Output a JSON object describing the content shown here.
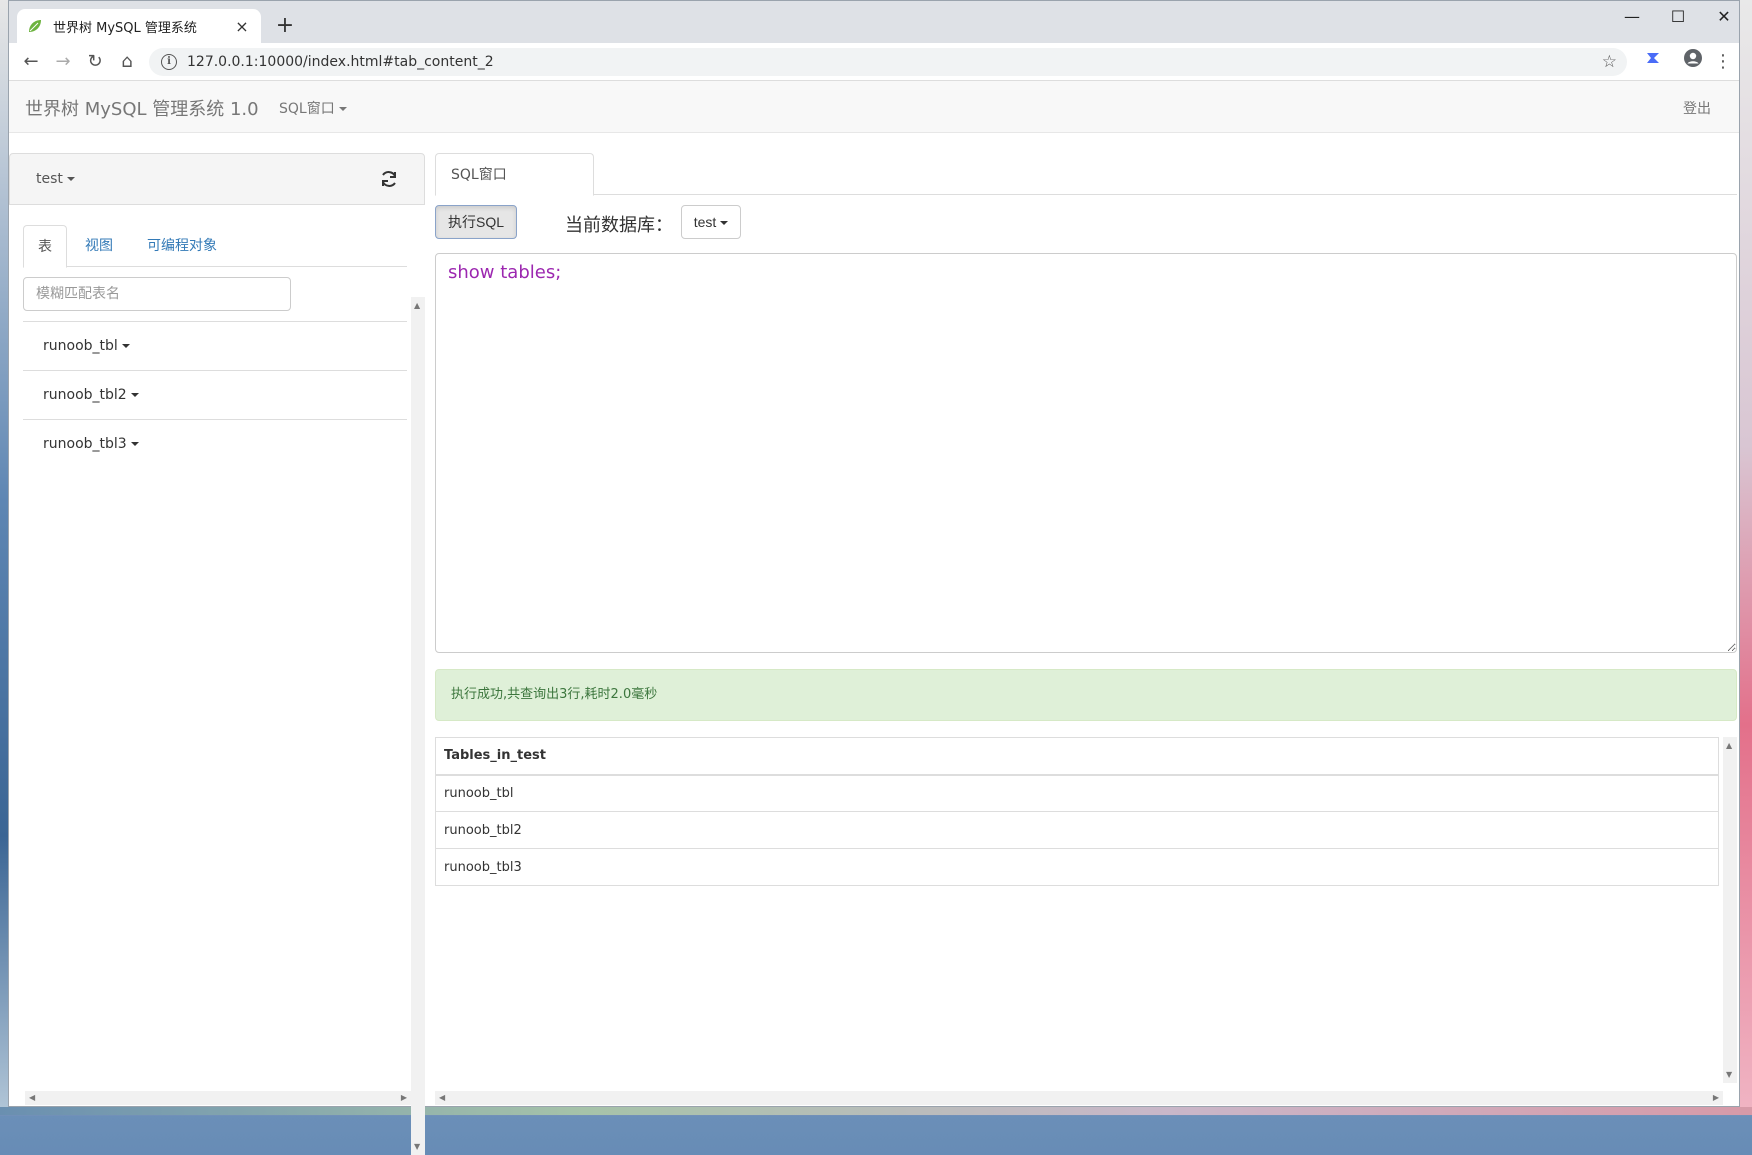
{
  "browser": {
    "tab_title": "世界树 MySQL 管理系统",
    "tab_close": "×",
    "new_tab": "+",
    "url": "127.0.0.1:10000/index.html#tab_content_2",
    "window_controls": {
      "minimize": "—",
      "maximize": "☐",
      "close": "✕"
    }
  },
  "header": {
    "brand": "世界树 MySQL 管理系统 1.0",
    "sql_menu": "SQL窗口",
    "logout": "登出"
  },
  "sidebar": {
    "database": "test",
    "tabs": [
      {
        "label": "表"
      },
      {
        "label": "视图"
      },
      {
        "label": "可编程对象"
      }
    ],
    "filter_placeholder": "模糊匹配表名",
    "tables": [
      {
        "label": "runoob_tbl"
      },
      {
        "label": "runoob_tbl2"
      },
      {
        "label": "runoob_tbl3"
      }
    ]
  },
  "main": {
    "tab_label": "SQL窗口",
    "execute_label": "执行SQL",
    "current_db_label": "当前数据库：",
    "current_db": "test",
    "sql_text": "show tables;",
    "result_message": "执行成功,共查询出3行,耗时2.0毫秒",
    "result_table": {
      "headers": [
        "Tables_in_test"
      ],
      "rows": [
        [
          "runoob_tbl"
        ],
        [
          "runoob_tbl2"
        ],
        [
          "runoob_tbl3"
        ]
      ]
    }
  },
  "colors": {
    "link": "#337ab7",
    "success_bg": "#dff0d8",
    "success_text": "#3c763d",
    "sql_text": "#9c27b0"
  }
}
